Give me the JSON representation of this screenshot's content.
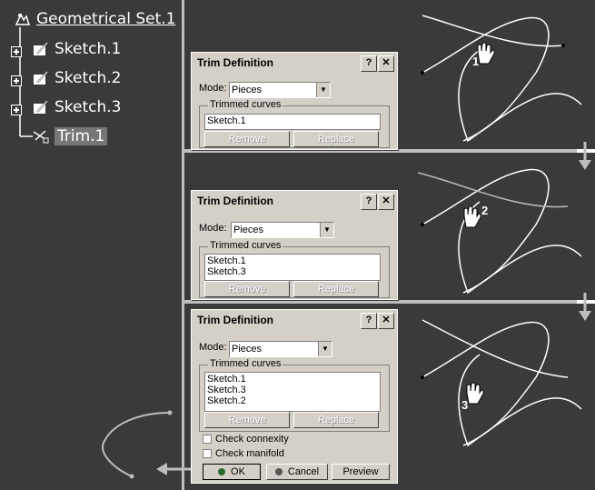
{
  "tree": {
    "root": "Geometrical Set.1",
    "items": [
      "Sketch.1",
      "Sketch.2",
      "Sketch.3"
    ],
    "selected": "Trim.1"
  },
  "dialogs": [
    {
      "title": "Trim Definition",
      "mode_label": "Mode:",
      "mode_value": "Pieces",
      "group_label": "Trimmed curves",
      "curves": [
        "Sketch.1"
      ],
      "remove": "Remove",
      "replace": "Replace",
      "step": "1"
    },
    {
      "title": "Trim Definition",
      "mode_label": "Mode:",
      "mode_value": "Pieces",
      "group_label": "Trimmed curves",
      "curves": [
        "Sketch.1",
        "Sketch.3"
      ],
      "remove": "Remove",
      "replace": "Replace",
      "step": "2"
    },
    {
      "title": "Trim Definition",
      "mode_label": "Mode:",
      "mode_value": "Pieces",
      "group_label": "Trimmed curves",
      "curves": [
        "Sketch.1",
        "Sketch.3",
        "Sketch.2"
      ],
      "remove": "Remove",
      "replace": "Replace",
      "check_connexity": "Check connexity",
      "check_manifold": "Check manifold",
      "ok": "OK",
      "cancel": "Cancel",
      "preview": "Preview",
      "step": "3"
    }
  ],
  "title_buttons": {
    "help": "?",
    "close": "✕"
  },
  "colors": {
    "background": "#3a3a3a",
    "dialog": "#d4d0c8",
    "divider": "#bdbdbd"
  }
}
